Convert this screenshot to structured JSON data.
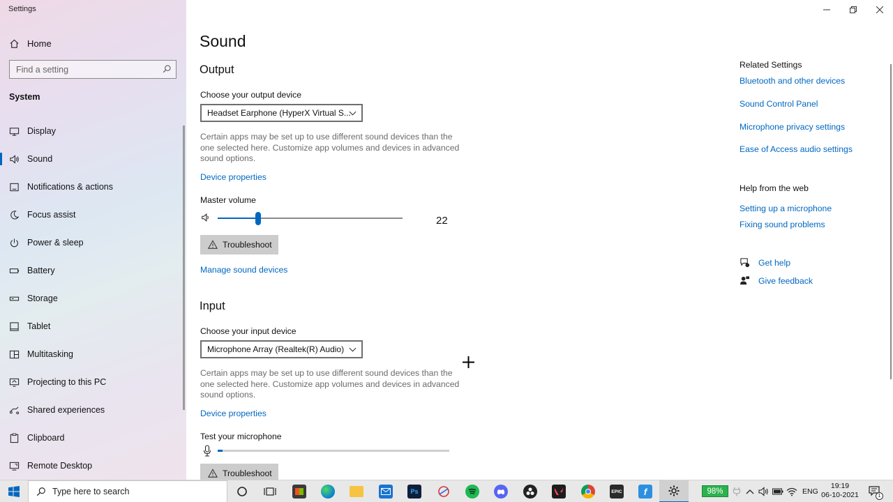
{
  "window": {
    "title": "Settings"
  },
  "sidebar": {
    "home_label": "Home",
    "search_placeholder": "Find a setting",
    "section_title": "System",
    "items": [
      {
        "label": "Display",
        "icon": "monitor-icon"
      },
      {
        "label": "Sound",
        "icon": "speaker-icon",
        "active": true
      },
      {
        "label": "Notifications & actions",
        "icon": "notification-icon"
      },
      {
        "label": "Focus assist",
        "icon": "moon-icon"
      },
      {
        "label": "Power & sleep",
        "icon": "power-icon"
      },
      {
        "label": "Battery",
        "icon": "battery-icon"
      },
      {
        "label": "Storage",
        "icon": "storage-icon"
      },
      {
        "label": "Tablet",
        "icon": "tablet-icon"
      },
      {
        "label": "Multitasking",
        "icon": "multitasking-icon"
      },
      {
        "label": "Projecting to this PC",
        "icon": "projector-icon"
      },
      {
        "label": "Shared experiences",
        "icon": "shared-icon"
      },
      {
        "label": "Clipboard",
        "icon": "clipboard-icon"
      },
      {
        "label": "Remote Desktop",
        "icon": "remote-desktop-icon"
      }
    ]
  },
  "main": {
    "title": "Sound",
    "output": {
      "heading": "Output",
      "choose_label": "Choose your output device",
      "device": "Headset Earphone (HyperX Virtual S...",
      "description": "Certain apps may be set up to use different sound devices than the one selected here. Customize app volumes and devices in advanced sound options.",
      "device_properties": "Device properties",
      "master_volume_label": "Master volume",
      "master_volume": 22,
      "master_volume_text": "22",
      "troubleshoot": "Troubleshoot",
      "manage_devices": "Manage sound devices"
    },
    "input": {
      "heading": "Input",
      "choose_label": "Choose your input device",
      "device": "Microphone Array (Realtek(R) Audio)",
      "description": "Certain apps may be set up to use different sound devices than the one selected here. Customize app volumes and devices in advanced sound options.",
      "device_properties": "Device properties",
      "test_label": "Test your microphone",
      "mic_level": 2,
      "troubleshoot": "Troubleshoot"
    }
  },
  "related": {
    "heading": "Related Settings",
    "links": [
      "Bluetooth and other devices",
      "Sound Control Panel",
      "Microphone privacy settings",
      "Ease of Access audio settings"
    ],
    "help_heading": "Help from the web",
    "help_links": [
      "Setting up a microphone",
      "Fixing sound problems"
    ],
    "get_help": "Get help",
    "give_feedback": "Give feedback"
  },
  "taskbar": {
    "search_placeholder": "Type here to search",
    "battery": "98%",
    "language": "ENG",
    "time": "19:19",
    "date": "06-10-2021",
    "notification_count": "1",
    "apps": [
      {
        "name": "cortana-icon",
        "label": ""
      },
      {
        "name": "task-view-icon",
        "label": ""
      },
      {
        "name": "store-icon",
        "label": ""
      },
      {
        "name": "edge-icon",
        "label": ""
      },
      {
        "name": "file-explorer-icon",
        "label": ""
      },
      {
        "name": "mail-icon",
        "label": ""
      },
      {
        "name": "photoshop-icon",
        "label": "Ps"
      },
      {
        "name": "snip-icon",
        "label": ""
      },
      {
        "name": "spotify-icon",
        "label": ""
      },
      {
        "name": "discord-icon",
        "label": ""
      },
      {
        "name": "obs-icon",
        "label": ""
      },
      {
        "name": "valorant-icon",
        "label": ""
      },
      {
        "name": "chrome-icon",
        "label": ""
      },
      {
        "name": "epic-games-icon",
        "label": "EPIC"
      },
      {
        "name": "fortnite-icon",
        "label": "f"
      },
      {
        "name": "settings-icon",
        "label": ""
      }
    ]
  },
  "colors": {
    "accent": "#0067c0",
    "link": "#0067c0",
    "battery": "#2bb24c"
  }
}
